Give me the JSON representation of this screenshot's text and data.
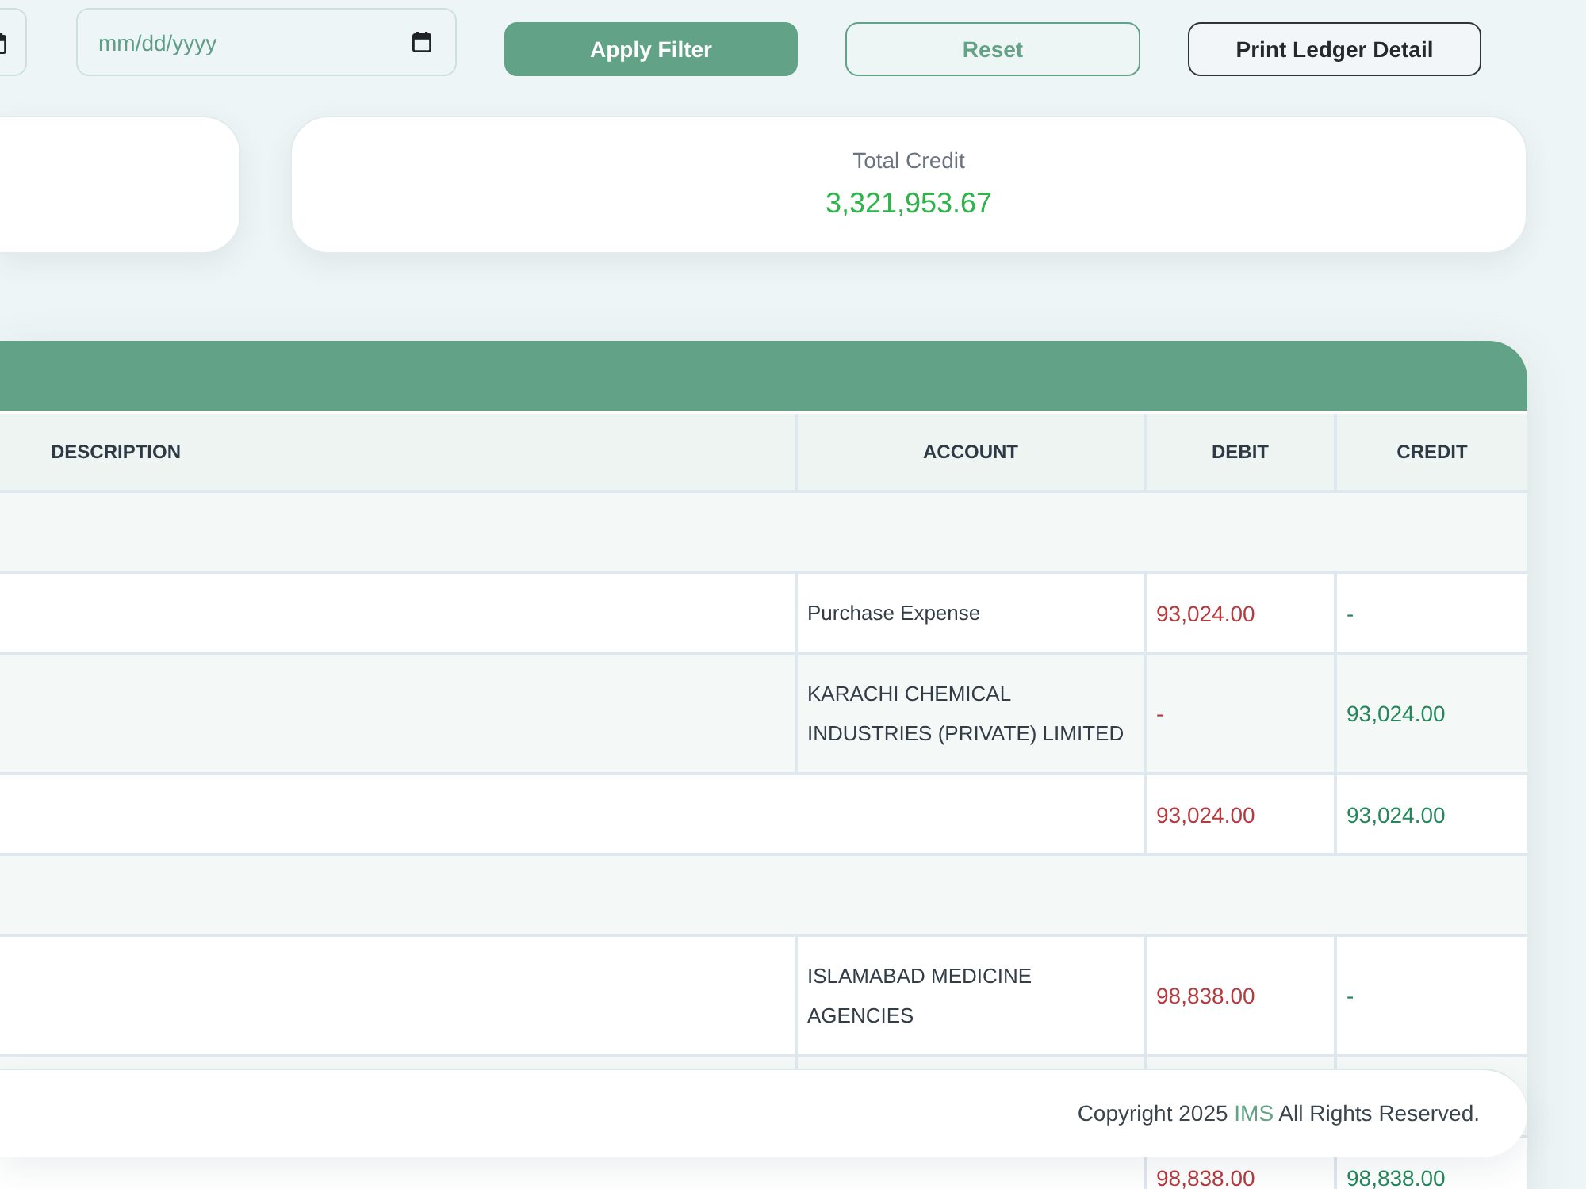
{
  "filter_bar": {
    "date_field": {
      "placeholder": "mm/dd/yyyy"
    },
    "buttons": [
      {
        "label": "Apply Filter",
        "kind": "primary"
      },
      {
        "label": "Reset",
        "kind": "secondary"
      },
      {
        "label": "Print Ledger Detail",
        "kind": "outline"
      }
    ]
  },
  "summary_cards": [
    {
      "label": "Total Credit",
      "value": "3,321,953.67"
    }
  ],
  "ledger_table": {
    "columns": [
      "DESCRIPTION",
      "ACCOUNT",
      "DEBIT",
      "CREDIT"
    ],
    "rows": [
      {
        "kind": "group"
      },
      {
        "kind": "entry",
        "account": "Purchase Expense",
        "debit": "93,024.00",
        "credit": "-"
      },
      {
        "kind": "entry",
        "account": "KARACHI CHEMICAL INDUSTRIES (PRIVATE) LIMITED",
        "debit": "-",
        "credit": "93,024.00"
      },
      {
        "kind": "total",
        "debit": "93,024.00",
        "credit": "93,024.00"
      },
      {
        "kind": "group"
      },
      {
        "kind": "entry",
        "account": "ISLAMABAD MEDICINE AGENCIES",
        "debit": "98,838.00",
        "credit": "-"
      },
      {
        "kind": "entry"
      },
      {
        "kind": "total",
        "debit": "98,838.00",
        "credit": "98,838.00"
      }
    ]
  },
  "footer": {
    "text_before": "Copyright 2025",
    "link": "IMS",
    "text_after": "All Rights Reserved."
  }
}
